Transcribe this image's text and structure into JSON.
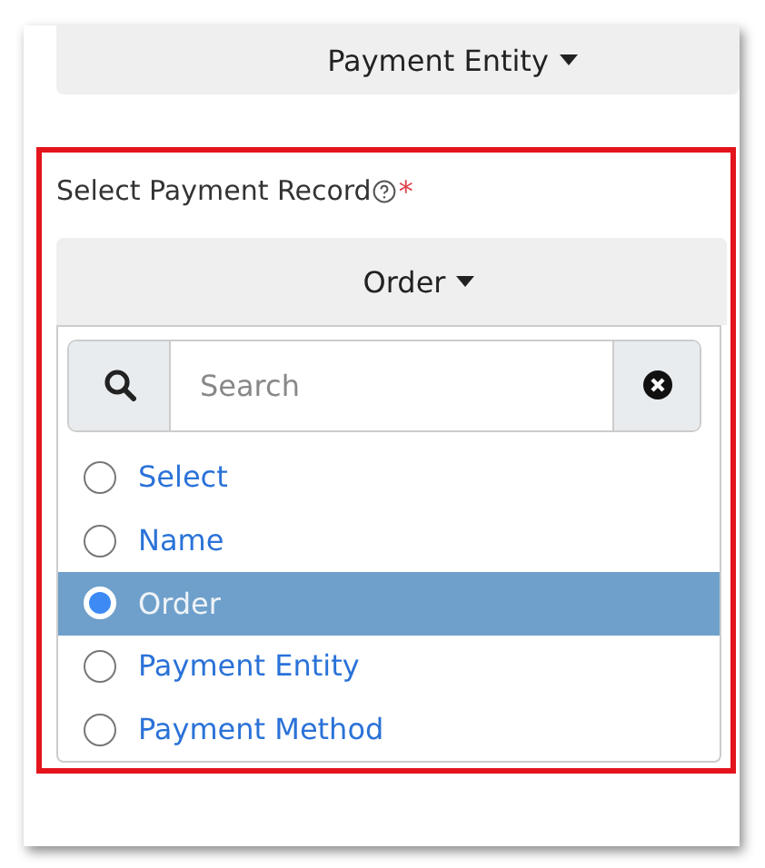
{
  "top_dropdown": {
    "label": "Payment Entity"
  },
  "field": {
    "label": "Select Payment Record",
    "required_mark": "*",
    "dropdown": {
      "label": "Order"
    },
    "menu": {
      "search": {
        "placeholder": "Search"
      },
      "options": [
        {
          "label": "Select",
          "selected": false
        },
        {
          "label": "Name",
          "selected": false
        },
        {
          "label": "Order",
          "selected": true
        },
        {
          "label": "Payment Entity",
          "selected": false
        },
        {
          "label": "Payment Method",
          "selected": false
        }
      ]
    }
  }
}
